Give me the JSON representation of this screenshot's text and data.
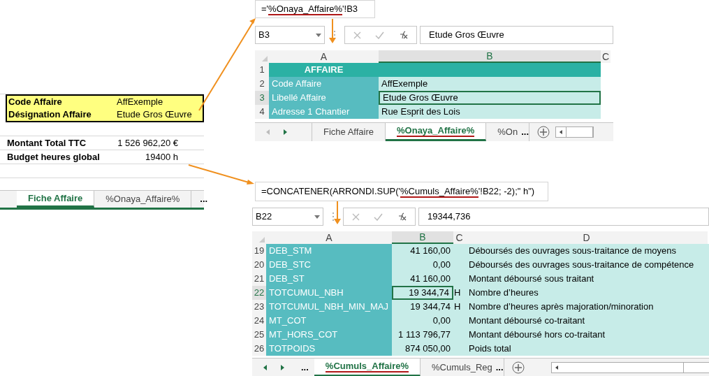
{
  "fiche_sheet": {
    "rows": [
      {
        "label": "Code Affaire",
        "value": "AffExemple",
        "highlighted": true
      },
      {
        "label": "Désignation Affaire",
        "value": "Etude Gros Œuvre",
        "highlighted": true
      },
      {
        "label": "",
        "value": "",
        "highlighted": false
      },
      {
        "label": "Montant Total TTC",
        "value": "1 526 962,20 €",
        "highlighted": false
      },
      {
        "label": "Budget heures global",
        "value": "19400 h",
        "highlighted": false
      }
    ],
    "tabs": [
      {
        "label": "Fiche Affaire",
        "selected": true,
        "underlined": false
      },
      {
        "label": "%Onaya_Affaire%",
        "selected": false,
        "underlined": false
      }
    ],
    "overflow": "..."
  },
  "formula_callout_1": {
    "before": "='",
    "underlined": "%Onaya_Affaire%",
    "after": "'!B3"
  },
  "affaire_sheet": {
    "name_box": "B3",
    "formula": "Etude Gros Œuvre",
    "columns": [
      {
        "label": "A",
        "selected": false
      },
      {
        "label": "B",
        "selected": true
      },
      {
        "label": "C",
        "selected": false
      }
    ],
    "rows": [
      {
        "number": "1",
        "kind": "header",
        "a": "AFFAIRE",
        "b": "",
        "selected": false
      },
      {
        "number": "2",
        "kind": "data",
        "a": "Code Affaire",
        "b": "AffExemple",
        "selected": false
      },
      {
        "number": "3",
        "kind": "data",
        "a": "Libellé Affaire",
        "b": "Etude Gros Œuvre",
        "selected": true
      },
      {
        "number": "4",
        "kind": "data",
        "a": "Adresse 1 Chantier",
        "b": "Rue Esprit des Lois",
        "selected": false
      }
    ],
    "tabs": [
      {
        "label": "Fiche Affaire",
        "selected": false,
        "underlined": false
      },
      {
        "label": "%Onaya_Affaire%",
        "selected": true,
        "underlined": true
      },
      {
        "label": "%On",
        "selected": false,
        "underlined": false
      }
    ],
    "overflow": "..."
  },
  "formula_callout_2": {
    "before": "=CONCATENER(ARRONDI.SUP('",
    "underlined": "%Cumuls_Affaire%",
    "after": "'!B22; -2);\" h\")"
  },
  "cumuls_sheet": {
    "name_box": "B22",
    "formula": "19344,736",
    "columns": [
      {
        "label": "A",
        "selected": false
      },
      {
        "label": "B",
        "selected": true
      },
      {
        "label": "C",
        "selected": false
      },
      {
        "label": "D",
        "selected": false
      }
    ],
    "rows": [
      {
        "number": "19",
        "a": "DEB_STM",
        "b": "41 160,00",
        "c": "",
        "d": "Déboursés des ouvrages sous-traitance de moyens",
        "selected": false
      },
      {
        "number": "20",
        "a": "DEB_STC",
        "b": "0,00",
        "c": "",
        "d": "Déboursés des ouvrages sous-traitance de compétence",
        "selected": false
      },
      {
        "number": "21",
        "a": "DEB_ST",
        "b": "41 160,00",
        "c": "",
        "d": "Montant déboursé sous traitant",
        "selected": false
      },
      {
        "number": "22",
        "a": "TOTCUMUL_NBH",
        "b": "19 344,74",
        "c": "H",
        "d": "Nombre d’heures",
        "selected": true
      },
      {
        "number": "23",
        "a": "TOTCUMUL_NBH_MIN_MAJ",
        "b": "19 344,74",
        "c": "H",
        "d": "Nombre d’heures après majoration/minoration",
        "selected": false
      },
      {
        "number": "24",
        "a": "MT_COT",
        "b": "0,00",
        "c": "",
        "d": "Montant déboursé co-traitant",
        "selected": false
      },
      {
        "number": "25",
        "a": "MT_HORS_COT",
        "b": "1 113 796,77",
        "c": "",
        "d": "Montant déboursé hors co-traitant",
        "selected": false
      },
      {
        "number": "26",
        "a": "TOTPOIDS",
        "b": "874 050,00",
        "c": "",
        "d": "Poids total",
        "selected": false
      }
    ],
    "leading_overflow": "...",
    "tabs": [
      {
        "label": "%Cumuls_Affaire%",
        "selected": true,
        "underlined": true
      },
      {
        "label": "%Cumuls_Reg",
        "selected": false,
        "underlined": false
      }
    ],
    "overflow": "..."
  }
}
